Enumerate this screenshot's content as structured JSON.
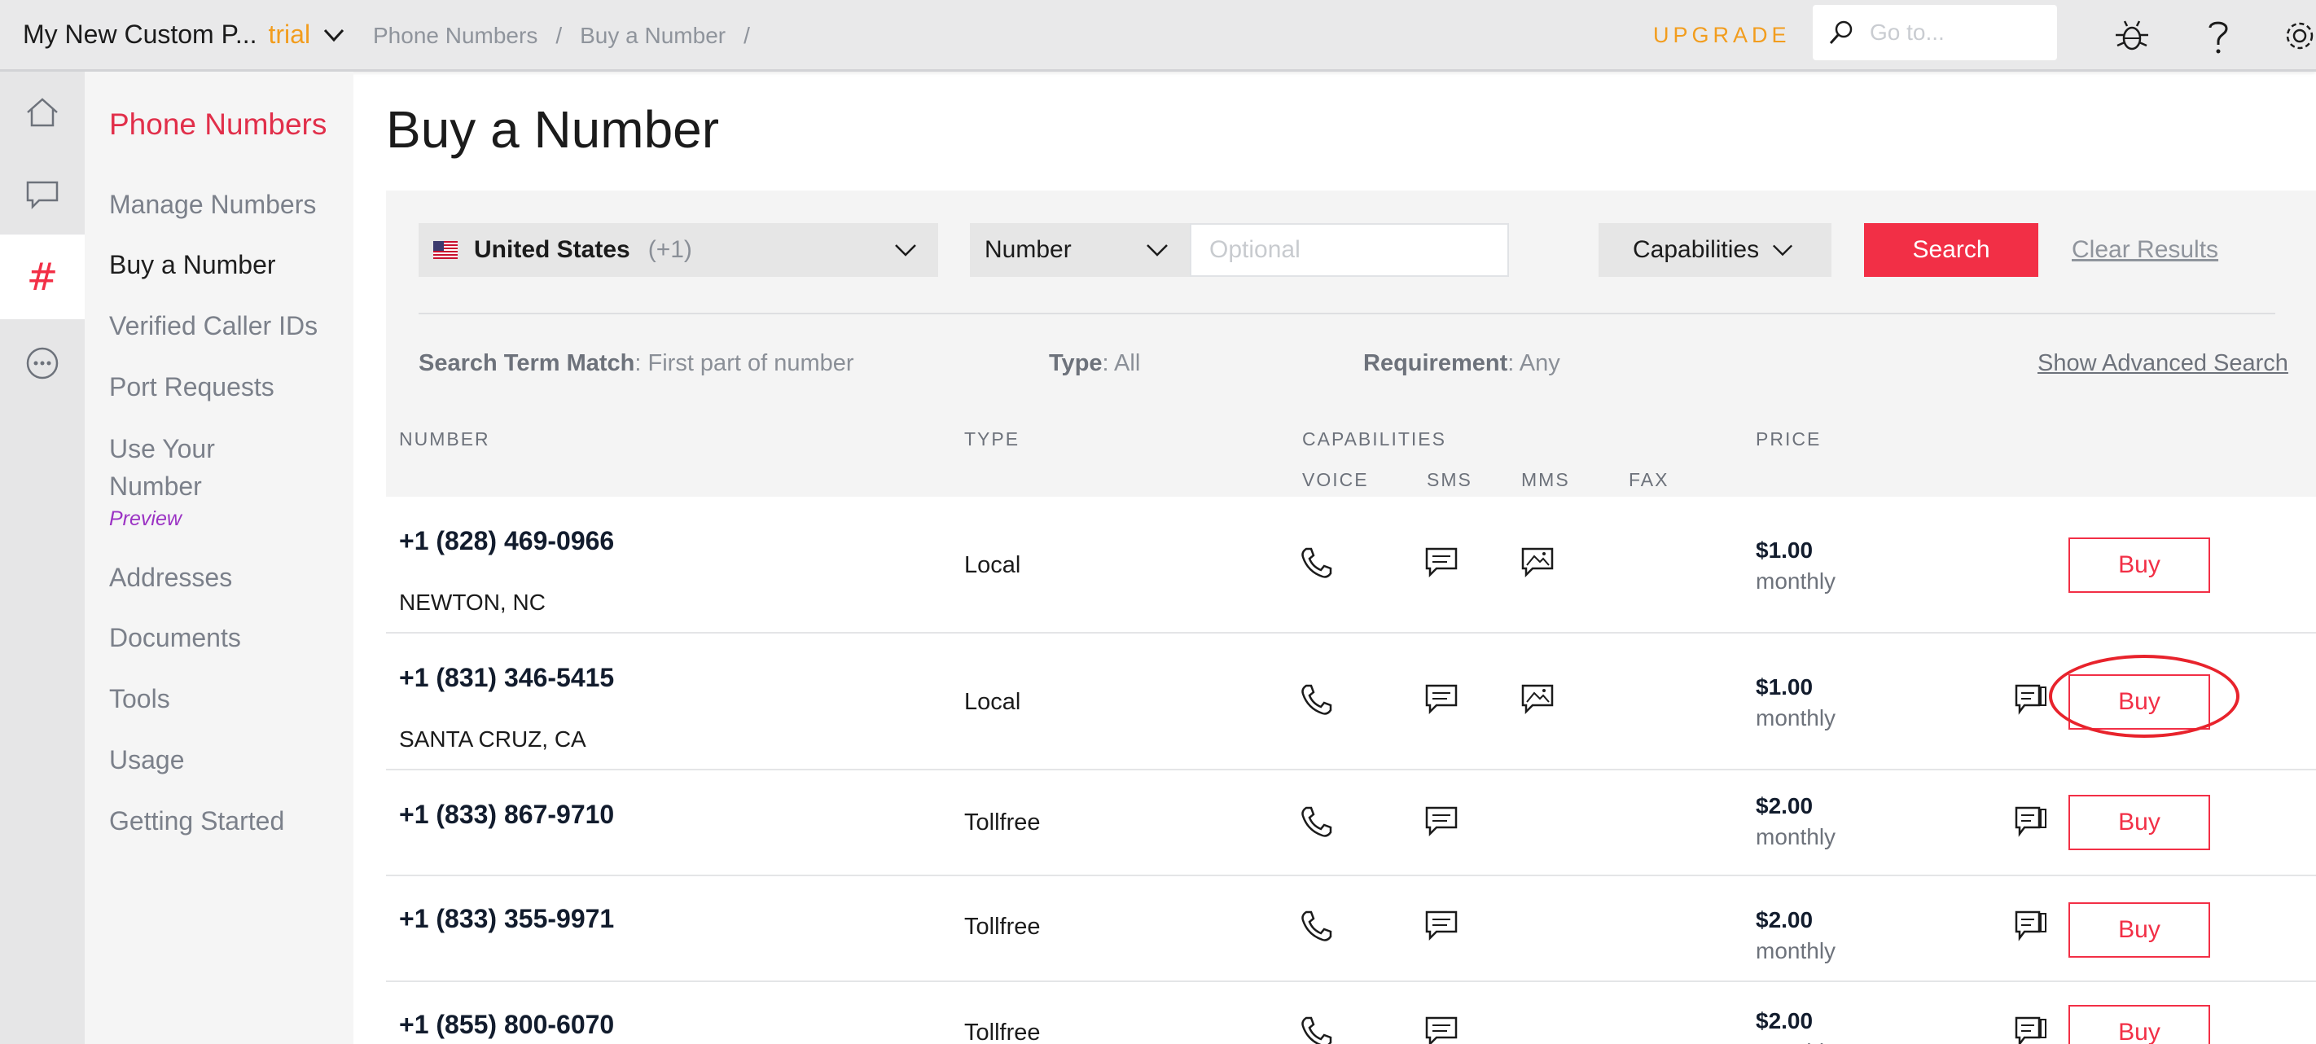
{
  "topbar": {
    "account_name": "My New Custom P...",
    "account_badge": "trial",
    "breadcrumbs": [
      "Phone Numbers",
      "/",
      "Buy a Number",
      "/"
    ],
    "upgrade_label": "UPGRADE",
    "goto_placeholder": "Go to..."
  },
  "rail": {
    "items": [
      "home-icon",
      "chat-icon",
      "hash-icon",
      "more-icon"
    ],
    "hash_glyph": "#"
  },
  "subnav": {
    "title": "Phone Numbers",
    "items": [
      "Manage Numbers",
      "Buy a Number",
      "Verified Caller IDs",
      "Port Requests",
      "Use Your Number",
      "Addresses",
      "Documents",
      "Tools",
      "Usage",
      "Getting Started"
    ],
    "preview_label": "Preview",
    "active": "Buy a Number"
  },
  "main": {
    "title": "Buy a Number",
    "search": {
      "country": "United States",
      "country_code": "(+1)",
      "number_select": "Number",
      "number_placeholder": "Optional",
      "capabilities_label": "Capabilities",
      "search_label": "Search",
      "clear_label": "Clear Results",
      "term_label": "Search Term Match",
      "term_value": ": First part of number",
      "type_label": "Type",
      "type_value": ": All",
      "req_label": "Requirement",
      "req_value": ": Any",
      "advanced_label": "Show Advanced Search"
    },
    "columns": {
      "number": "NUMBER",
      "type": "TYPE",
      "capabilities": "CAPABILITIES",
      "voice": "VOICE",
      "sms": "SMS",
      "mms": "MMS",
      "fax": "FAX",
      "price": "PRICE"
    },
    "rows": [
      {
        "number": "+1 (828) 469-0966",
        "location": "NEWTON, NC",
        "type": "Local",
        "voice": true,
        "sms": true,
        "mms": true,
        "fax": false,
        "price": "$1.00",
        "period": "monthly",
        "buy": "Buy"
      },
      {
        "number": "+1 (831) 346-5415",
        "location": "SANTA CRUZ, CA",
        "type": "Local",
        "voice": true,
        "sms": true,
        "mms": true,
        "fax": true,
        "price": "$1.00",
        "period": "monthly",
        "buy": "Buy"
      },
      {
        "number": "+1 (833) 867-9710",
        "location": "",
        "type": "Tollfree",
        "voice": true,
        "sms": true,
        "mms": false,
        "fax": true,
        "price": "$2.00",
        "period": "monthly",
        "buy": "Buy"
      },
      {
        "number": "+1 (833) 355-9971",
        "location": "",
        "type": "Tollfree",
        "voice": true,
        "sms": true,
        "mms": false,
        "fax": true,
        "price": "$2.00",
        "period": "monthly",
        "buy": "Buy"
      },
      {
        "number": "+1 (855) 800-6070",
        "location": "",
        "type": "Tollfree",
        "voice": true,
        "sms": true,
        "mms": false,
        "fax": true,
        "price": "$2.00",
        "period": "monthly",
        "buy": "Buy"
      }
    ]
  },
  "colors": {
    "accent": "#f22f46",
    "trial": "#f29d1e",
    "preview": "#9b33c4",
    "highlight_ring": "#e8232c"
  }
}
